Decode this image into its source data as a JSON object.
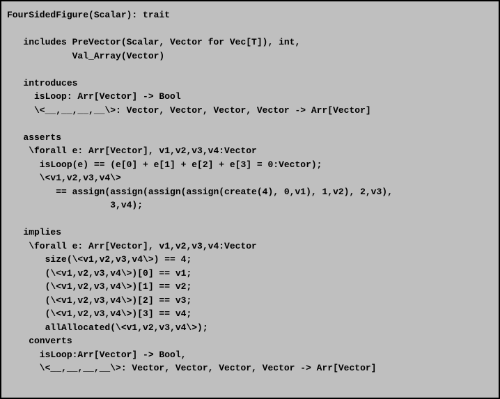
{
  "code_lines": [
    "FourSidedFigure(Scalar): trait",
    "",
    "   includes PreVector(Scalar, Vector for Vec[T]), int,",
    "            Val_Array(Vector)",
    "",
    "   introduces",
    "     isLoop: Arr[Vector] -> Bool",
    "     \\<__,__,__,__\\>: Vector, Vector, Vector, Vector -> Arr[Vector]",
    "",
    "   asserts",
    "    \\forall e: Arr[Vector], v1,v2,v3,v4:Vector",
    "      isLoop(e) == (e[0] + e[1] + e[2] + e[3] = 0:Vector);",
    "      \\<v1,v2,v3,v4\\>",
    "         == assign(assign(assign(assign(create(4), 0,v1), 1,v2), 2,v3),",
    "                   3,v4);",
    "",
    "   implies",
    "    \\forall e: Arr[Vector], v1,v2,v3,v4:Vector",
    "       size(\\<v1,v2,v3,v4\\>) == 4;",
    "       (\\<v1,v2,v3,v4\\>)[0] == v1;",
    "       (\\<v1,v2,v3,v4\\>)[1] == v2;",
    "       (\\<v1,v2,v3,v4\\>)[2] == v3;",
    "       (\\<v1,v2,v3,v4\\>)[3] == v4;",
    "       allAllocated(\\<v1,v2,v3,v4\\>);",
    "    converts",
    "      isLoop:Arr[Vector] -> Bool,",
    "      \\<__,__,__,__\\>: Vector, Vector, Vector, Vector -> Arr[Vector]"
  ]
}
